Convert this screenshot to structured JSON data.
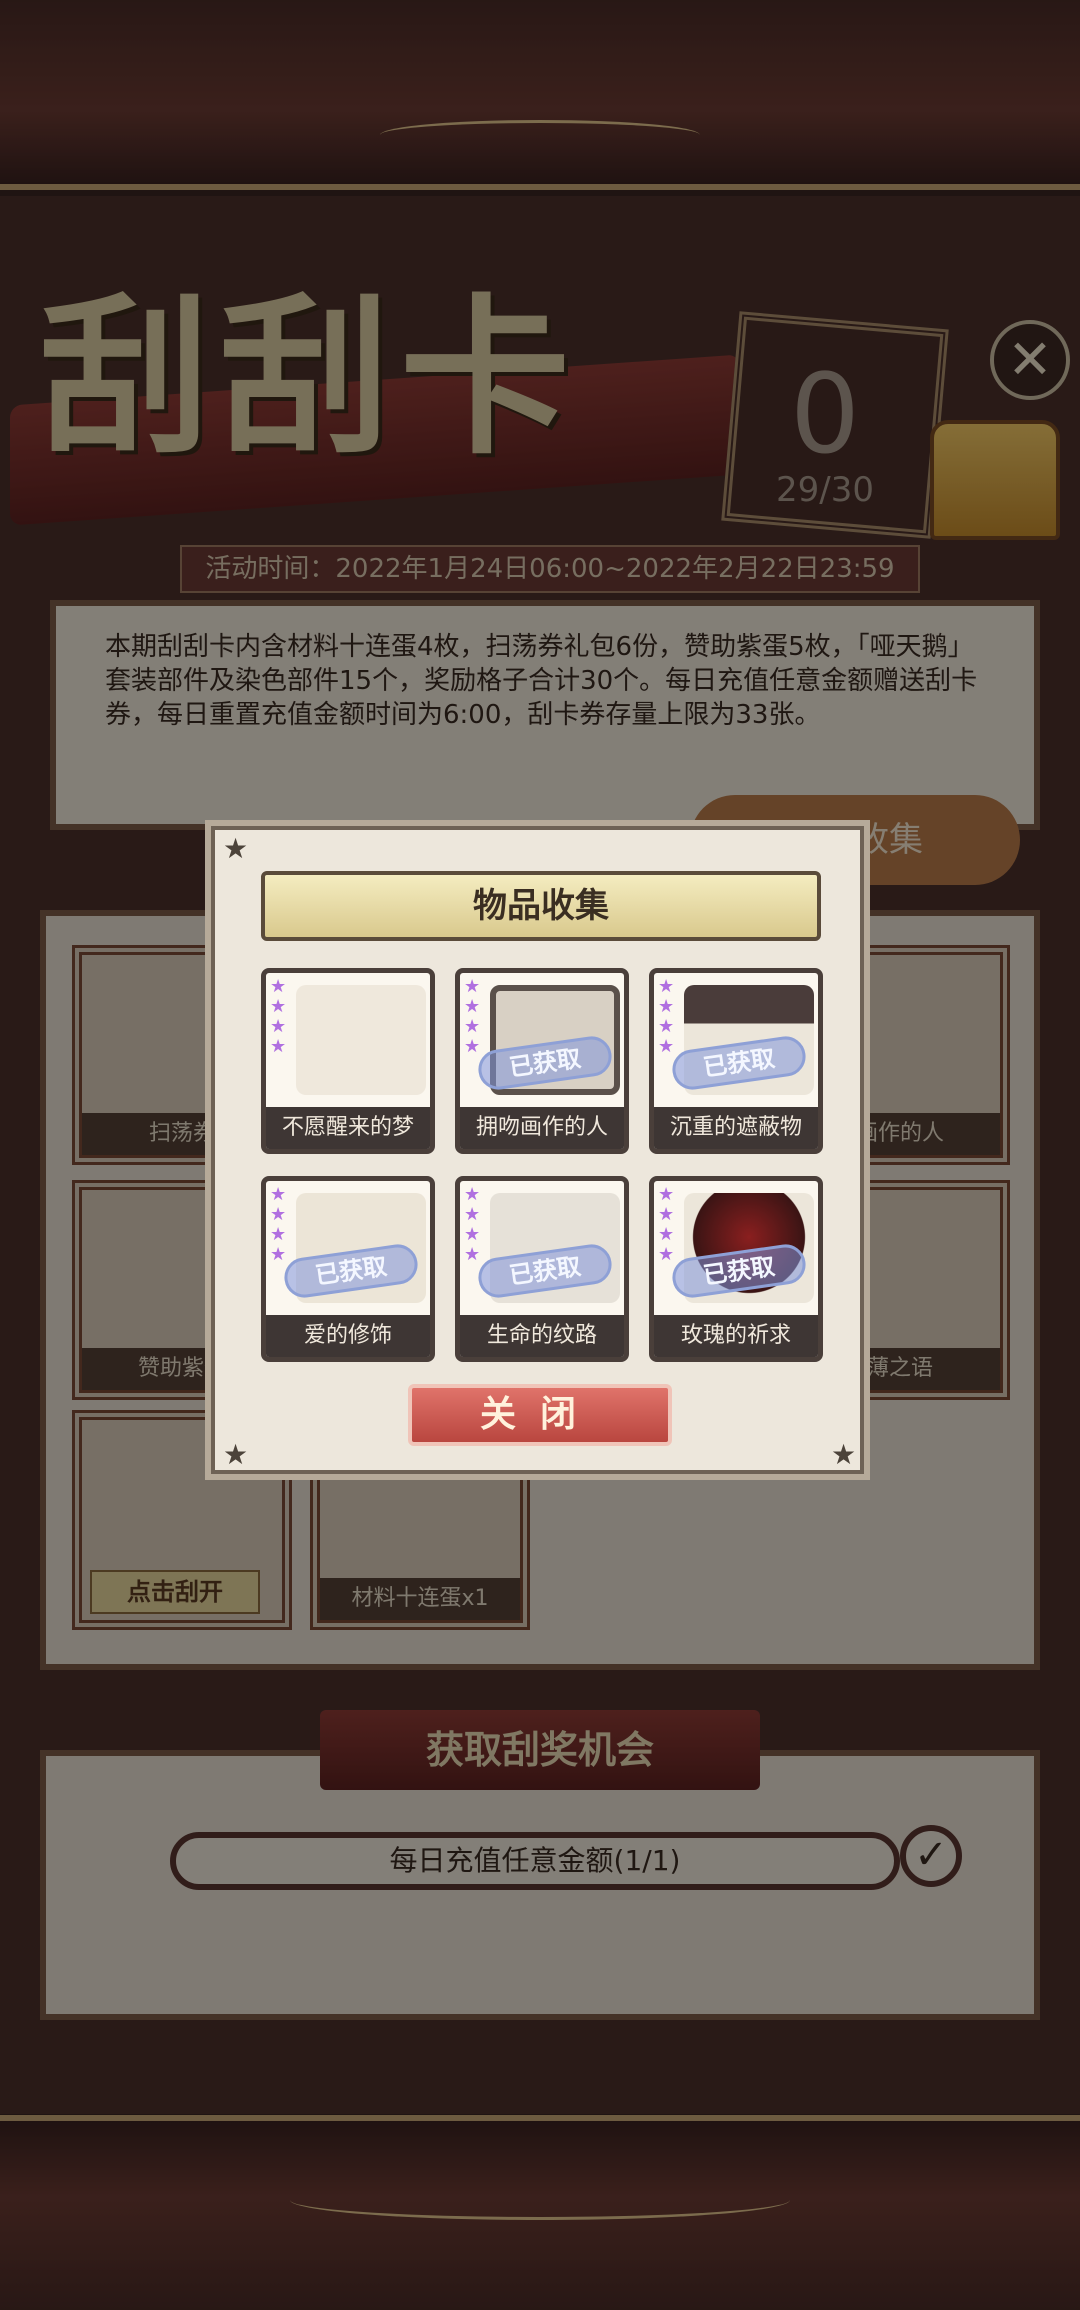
{
  "header": {
    "title": "刮刮卡",
    "remaining": "0",
    "remaining_ratio": "29/30",
    "event_time": "活动时间：2022年1月24日06:00~2022年2月22日23:59"
  },
  "description": "本期刮刮卡内含材料十连蛋4枚，扫荡券礼包6份，赞助紫蛋5枚，「哑天鹅」套装部件及染色部件15个，奖励格子合计30个。每日充值任意金额赠送刮卡券，每日重置充值金额时间为6:00，刮卡券存量上限为33张。",
  "collection_button": "物品收集",
  "grid": {
    "cells": [
      {
        "label": "扫荡券"
      },
      {
        "label": "画作的人"
      },
      {
        "label": "赞助紫蛋"
      },
      {
        "label": "薄之语"
      },
      {
        "label": "点击刮开"
      },
      {
        "label": "材料十连蛋x1"
      }
    ]
  },
  "chance": {
    "header": "获取刮奖机会",
    "daily_task": "每日充值任意金额(1/1)",
    "daily_done": true
  },
  "modal": {
    "title": "物品收集",
    "obtained_stamp": "已获取",
    "items": [
      {
        "name": "不愿醒来的梦",
        "obtained": false
      },
      {
        "name": "拥吻画作的人",
        "obtained": true
      },
      {
        "name": "沉重的遮蔽物",
        "obtained": true
      },
      {
        "name": "爱的修饰",
        "obtained": true
      },
      {
        "name": "生命的纹路",
        "obtained": true
      },
      {
        "name": "玫瑰的祈求",
        "obtained": true
      }
    ],
    "close_button": "关闭"
  },
  "colors": {
    "accent_red": "#b9463f",
    "frame_brown": "#4c302b",
    "gold": "#e2c58d",
    "rarity_purple": "#b06fe0"
  }
}
